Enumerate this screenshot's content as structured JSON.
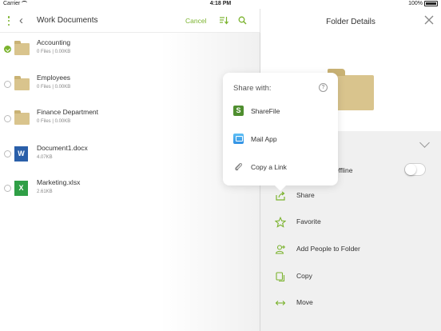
{
  "status_bar": {
    "carrier": "Carrier",
    "time": "4:18 PM",
    "battery": "100%"
  },
  "left": {
    "title": "Work Documents",
    "cancel_label": "Cancel",
    "files": [
      {
        "name": "Accounting",
        "meta": "0 Files  |  0.00KB",
        "type": "folder",
        "selected": true
      },
      {
        "name": "Employees",
        "meta": "0 Files  |  0.00KB",
        "type": "folder",
        "selected": false
      },
      {
        "name": "Finance Department",
        "meta": "0 Files  |  0.00KB",
        "type": "folder",
        "selected": false
      },
      {
        "name": "Document1.docx",
        "meta": "4.07KB",
        "type": "word",
        "icon_letter": "W",
        "selected": false
      },
      {
        "name": "Marketing.xlsx",
        "meta": "2.61KB",
        "type": "excel",
        "icon_letter": "X",
        "selected": false
      }
    ]
  },
  "right": {
    "title": "Folder Details",
    "offline_label": "e Offline",
    "actions": [
      {
        "label": "Share",
        "icon": "share-icon"
      },
      {
        "label": "Favorite",
        "icon": "star-icon"
      },
      {
        "label": "Add People to Folder",
        "icon": "add-person-icon"
      },
      {
        "label": "Copy",
        "icon": "copy-icon"
      },
      {
        "label": "Move",
        "icon": "move-icon"
      }
    ]
  },
  "popover": {
    "title": "Share with:",
    "help": "?",
    "items": [
      {
        "label": "ShareFile",
        "icon": "sharefile-icon",
        "icon_letter": "S"
      },
      {
        "label": "Mail App",
        "icon": "mail-icon"
      },
      {
        "label": "Copy a Link",
        "icon": "paperclip-icon"
      }
    ]
  },
  "colors": {
    "accent": "#7bb32e",
    "folder": "#d9c48d",
    "word": "#2a5fa9",
    "excel": "#2f9f46"
  }
}
